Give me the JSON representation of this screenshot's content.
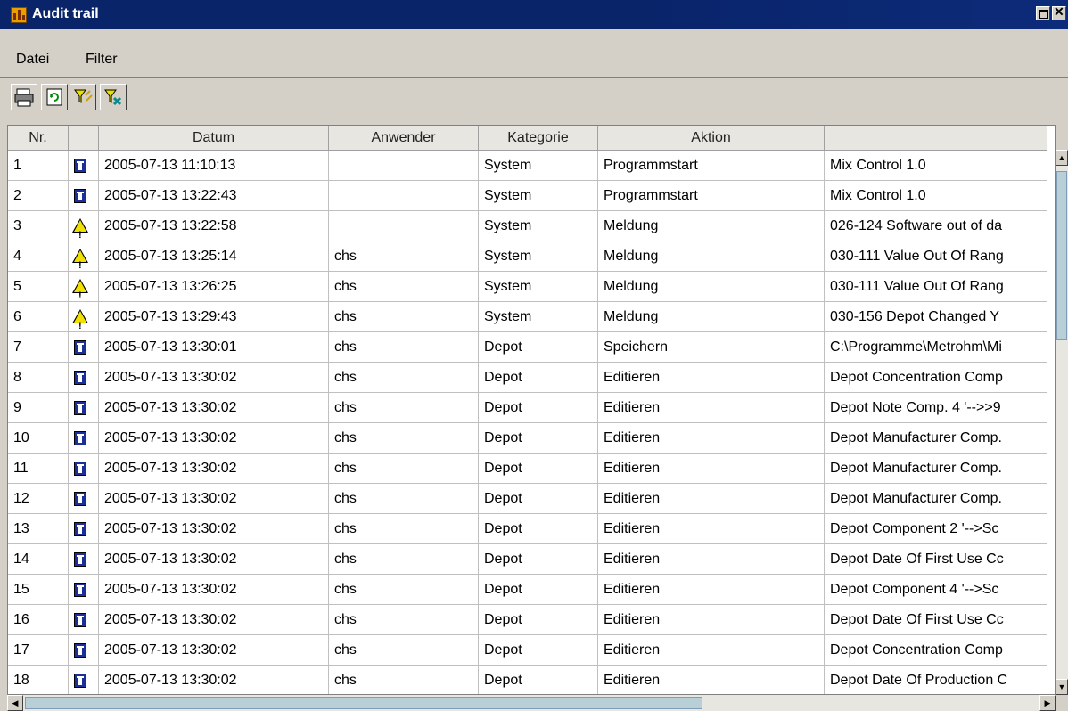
{
  "window": {
    "title": "Audit trail"
  },
  "menu": [
    {
      "label": "Datei"
    },
    {
      "label": "Filter"
    }
  ],
  "toolbar": {
    "buttons": [
      {
        "icon": "print-icon"
      },
      {
        "icon": "refresh-icon"
      },
      {
        "icon": "filter-icon"
      },
      {
        "icon": "clear-filter-icon"
      }
    ]
  },
  "columns": [
    "Nr.",
    "",
    "Datum",
    "Anwender",
    "Kategorie",
    "Aktion",
    ""
  ],
  "rows": [
    {
      "nr": "1",
      "icon": "info",
      "datum": "2005-07-13 11:10:13",
      "anwender": "",
      "kategorie": "System",
      "aktion": "Programmstart",
      "detail": "Mix Control 1.0"
    },
    {
      "nr": "2",
      "icon": "info",
      "datum": "2005-07-13 13:22:43",
      "anwender": "",
      "kategorie": "System",
      "aktion": "Programmstart",
      "detail": "Mix Control 1.0"
    },
    {
      "nr": "3",
      "icon": "warning",
      "datum": "2005-07-13 13:22:58",
      "anwender": "",
      "kategorie": "System",
      "aktion": "Meldung",
      "detail": "026-124 Software out of da"
    },
    {
      "nr": "4",
      "icon": "warning",
      "datum": "2005-07-13 13:25:14",
      "anwender": "chs",
      "kategorie": "System",
      "aktion": "Meldung",
      "detail": "030-111 Value Out Of Rang"
    },
    {
      "nr": "5",
      "icon": "warning",
      "datum": "2005-07-13 13:26:25",
      "anwender": "chs",
      "kategorie": "System",
      "aktion": "Meldung",
      "detail": "030-111 Value Out Of Rang"
    },
    {
      "nr": "6",
      "icon": "warning",
      "datum": "2005-07-13 13:29:43",
      "anwender": "chs",
      "kategorie": "System",
      "aktion": "Meldung",
      "detail": "030-156 Depot Changed Y"
    },
    {
      "nr": "7",
      "icon": "info",
      "datum": "2005-07-13 13:30:01",
      "anwender": "chs",
      "kategorie": "Depot",
      "aktion": "Speichern",
      "detail": "C:\\Programme\\Metrohm\\Mi"
    },
    {
      "nr": "8",
      "icon": "info",
      "datum": "2005-07-13 13:30:02",
      "anwender": "chs",
      "kategorie": "Depot",
      "aktion": "Editieren",
      "detail": "Depot Concentration Comp"
    },
    {
      "nr": "9",
      "icon": "info",
      "datum": "2005-07-13 13:30:02",
      "anwender": "chs",
      "kategorie": "Depot",
      "aktion": "Editieren",
      "detail": "Depot Note Comp. 4 '-->>9"
    },
    {
      "nr": "10",
      "icon": "info",
      "datum": "2005-07-13 13:30:02",
      "anwender": "chs",
      "kategorie": "Depot",
      "aktion": "Editieren",
      "detail": "Depot Manufacturer Comp."
    },
    {
      "nr": "11",
      "icon": "info",
      "datum": "2005-07-13 13:30:02",
      "anwender": "chs",
      "kategorie": "Depot",
      "aktion": "Editieren",
      "detail": "Depot Manufacturer Comp."
    },
    {
      "nr": "12",
      "icon": "info",
      "datum": "2005-07-13 13:30:02",
      "anwender": "chs",
      "kategorie": "Depot",
      "aktion": "Editieren",
      "detail": "Depot Manufacturer Comp."
    },
    {
      "nr": "13",
      "icon": "info",
      "datum": "2005-07-13 13:30:02",
      "anwender": "chs",
      "kategorie": "Depot",
      "aktion": "Editieren",
      "detail": "Depot Component 2 '-->Sc"
    },
    {
      "nr": "14",
      "icon": "info",
      "datum": "2005-07-13 13:30:02",
      "anwender": "chs",
      "kategorie": "Depot",
      "aktion": "Editieren",
      "detail": "Depot Date Of First Use Cc"
    },
    {
      "nr": "15",
      "icon": "info",
      "datum": "2005-07-13 13:30:02",
      "anwender": "chs",
      "kategorie": "Depot",
      "aktion": "Editieren",
      "detail": "Depot Component 4 '-->Sc"
    },
    {
      "nr": "16",
      "icon": "info",
      "datum": "2005-07-13 13:30:02",
      "anwender": "chs",
      "kategorie": "Depot",
      "aktion": "Editieren",
      "detail": "Depot Date Of First Use Cc"
    },
    {
      "nr": "17",
      "icon": "info",
      "datum": "2005-07-13 13:30:02",
      "anwender": "chs",
      "kategorie": "Depot",
      "aktion": "Editieren",
      "detail": "Depot Concentration Comp"
    },
    {
      "nr": "18",
      "icon": "info",
      "datum": "2005-07-13 13:30:02",
      "anwender": "chs",
      "kategorie": "Depot",
      "aktion": "Editieren",
      "detail": "Depot Date Of Production C"
    }
  ],
  "colors": {
    "titlebar": "#0a246a",
    "info_icon": "#1a2f9a",
    "warning_icon": "#f0e000"
  }
}
